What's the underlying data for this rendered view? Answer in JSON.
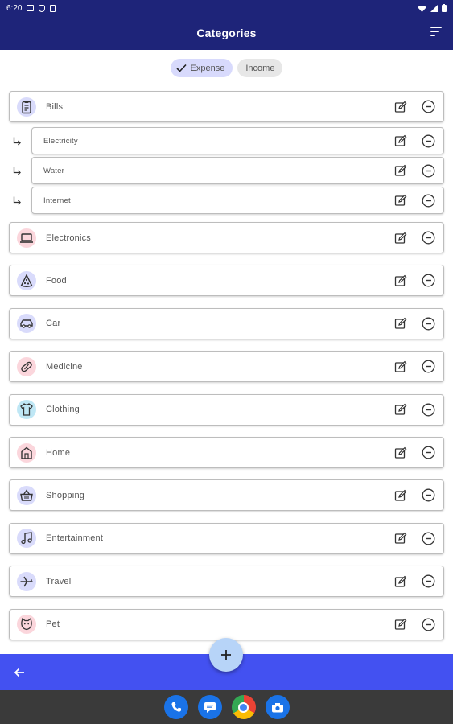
{
  "status_bar": {
    "time": "6:20"
  },
  "app_bar": {
    "title": "Categories",
    "sort_icon": "sort-icon"
  },
  "chips": {
    "expense": "Expense",
    "income": "Income"
  },
  "categories": [
    {
      "name": "Bills",
      "icon": "clipboard-icon",
      "color": "#d9dbfb"
    },
    {
      "name": "Electricity",
      "sub": true
    },
    {
      "name": "Water",
      "sub": true
    },
    {
      "name": "Internet",
      "sub": true
    },
    {
      "name": "Electronics",
      "icon": "laptop-icon",
      "color": "#fbd6dc"
    },
    {
      "name": "Food",
      "icon": "pizza-icon",
      "color": "#d9dbfb"
    },
    {
      "name": "Car",
      "icon": "car-icon",
      "color": "#d9dbfb"
    },
    {
      "name": "Medicine",
      "icon": "pill-icon",
      "color": "#fbd6dc"
    },
    {
      "name": "Clothing",
      "icon": "shirt-icon",
      "color": "#bfe7f5"
    },
    {
      "name": "Home",
      "icon": "house-icon",
      "color": "#fbd6dc"
    },
    {
      "name": "Shopping",
      "icon": "basket-icon",
      "color": "#d9dbfb"
    },
    {
      "name": "Entertainment",
      "icon": "music-icon",
      "color": "#d9dbfb"
    },
    {
      "name": "Travel",
      "icon": "airplane-icon",
      "color": "#d9dbfb"
    },
    {
      "name": "Pet",
      "icon": "cat-icon",
      "color": "#fbd6dc"
    }
  ],
  "colors": {
    "app_bar": "#1e2479",
    "bottom_bar": "#4351f1",
    "fab": "#b7d4f8",
    "chip_selected": "#d8dafc"
  }
}
